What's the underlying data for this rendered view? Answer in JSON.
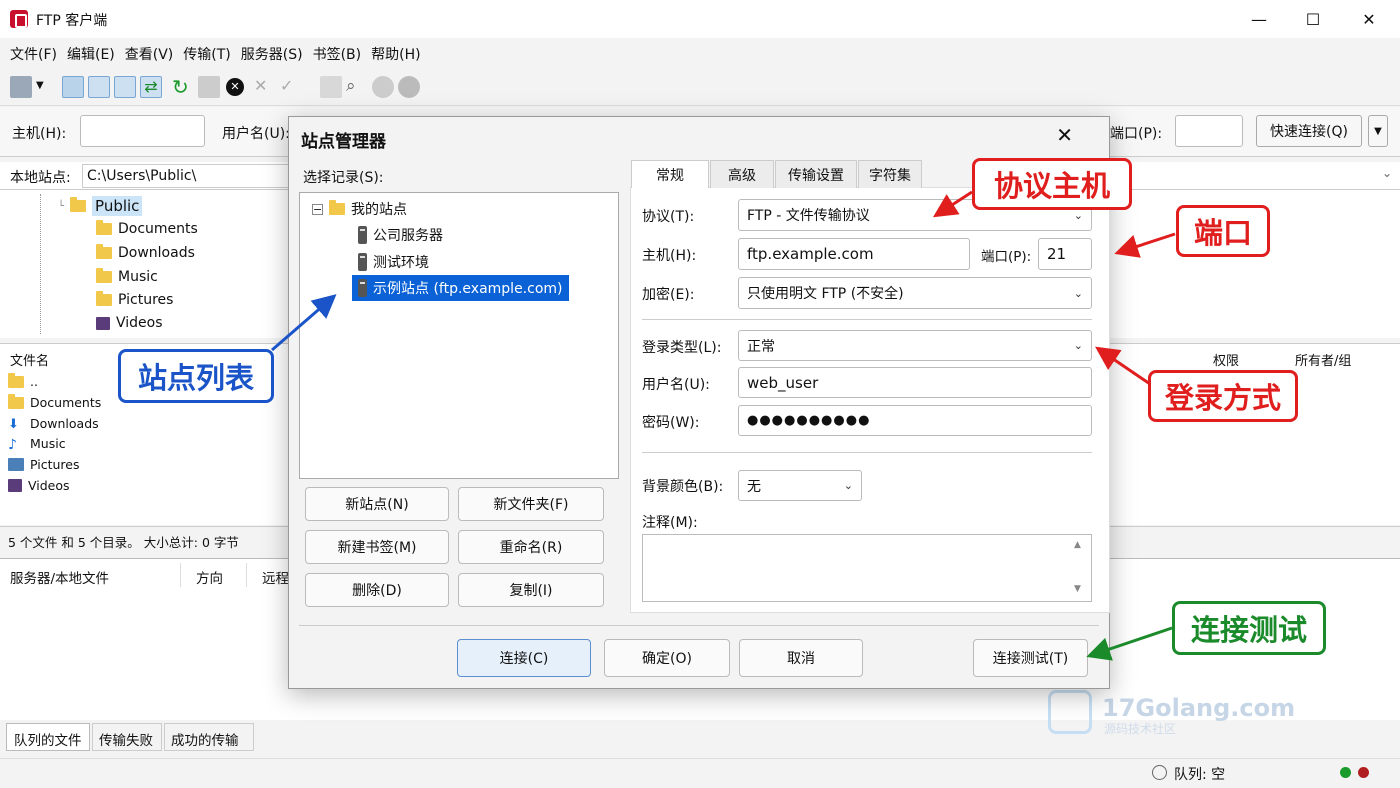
{
  "window": {
    "title": "FTP 客户端",
    "min": "—",
    "max": "☐",
    "close": "✕"
  },
  "menu": [
    "文件(F)",
    "编辑(E)",
    "查看(V)",
    "传输(T)",
    "服务器(S)",
    "书签(B)",
    "帮助(H)"
  ],
  "quick": {
    "host_label": "主机(H):",
    "user_label": "用户名(U):",
    "port_label": "端口(P):",
    "connect_label": "快速连接(Q)"
  },
  "local": {
    "site_label": "本地站点:",
    "path": "C:\\Users\\Public\\",
    "tree": [
      "Public",
      "Documents",
      "Downloads",
      "Music",
      "Pictures",
      "Videos"
    ],
    "list_header": "文件名",
    "files": [
      "..",
      "Documents",
      "Downloads",
      "Music",
      "Pictures",
      "Videos"
    ],
    "summary": "5 个文件 和 5 个目录。 大小总计: 0 字节"
  },
  "remote": {
    "col_perm": "权限",
    "col_owner": "所有者/组"
  },
  "queue": {
    "col_local": "服务器/本地文件",
    "col_dir": "方向",
    "col_remote": "远程",
    "tabs": [
      "队列的文件",
      "传输失败",
      "成功的传输"
    ],
    "status": "队列: 空"
  },
  "dialog": {
    "title": "站点管理器",
    "close": "✕",
    "select_label": "选择记录(S):",
    "root": "我的站点",
    "sites": [
      "公司服务器",
      "测试环境",
      "示例站点 (ftp.example.com)"
    ],
    "buttons_left": [
      "新站点(N)",
      "新文件夹(F)",
      "新建书签(M)",
      "重命名(R)",
      "删除(D)",
      "复制(I)"
    ],
    "tabs": [
      "常规",
      "高级",
      "传输设置",
      "字符集"
    ],
    "protocol_label": "协议(T):",
    "protocol_value": "FTP - 文件传输协议",
    "host_label": "主机(H):",
    "host_value": "ftp.example.com",
    "port_label": "端口(P):",
    "port_value": "21",
    "encryption_label": "加密(E):",
    "encryption_value": "只使用明文 FTP (不安全)",
    "logon_label": "登录类型(L):",
    "logon_value": "正常",
    "user_label": "用户名(U):",
    "user_value": "web_user",
    "pass_label": "密码(W):",
    "pass_value": "●●●●●●●●●●",
    "bg_label": "背景颜色(B):",
    "bg_value": "无",
    "comment_label": "注释(M):",
    "footer": [
      "连接(C)",
      "确定(O)",
      "取消",
      "连接测试(T)"
    ]
  },
  "callouts": {
    "protocol_host": "协议主机",
    "port": "端口",
    "site_list": "站点列表",
    "login": "登录方式",
    "test": "连接测试"
  },
  "watermark": {
    "brand": "17Golang.com",
    "sub": "源码技术社区"
  },
  "colors": {
    "callout_red": "#e01e1e",
    "callout_blue": "#1a54c8",
    "callout_green": "#1a8a2a",
    "selection": "#0b62d6"
  }
}
